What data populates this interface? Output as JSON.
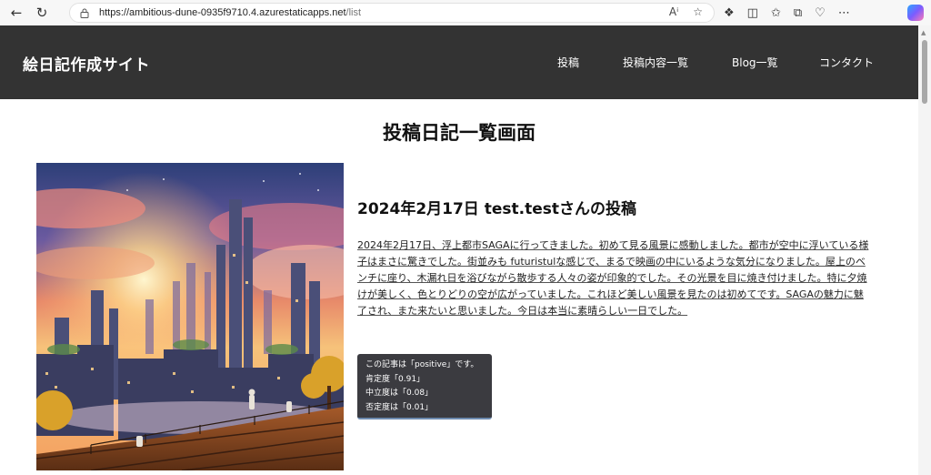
{
  "browser": {
    "url_host": "https://ambitious-dune-0935f9710.4.azurestaticapps.net",
    "url_path": "/list"
  },
  "site": {
    "title": "絵日記作成サイト",
    "nav": [
      "投稿",
      "投稿内容一覧",
      "Blog一覧",
      "コンタクト"
    ]
  },
  "page": {
    "heading": "投稿日記一覧画面"
  },
  "post": {
    "title": "2024年2月17日 test.testさんの投稿",
    "body": "2024年2月17日、浮上都市SAGAに行ってきました。初めて見る風景に感動しました。都市が空中に浮いている様子はまさに驚きでした。街並みも futuristulな感じで、まるで映画の中にいるような気分になりました。屋上のベンチに座り、木漏れ日を浴びながら散歩する人々の姿が印象的でした。その光景を目に焼き付けました。特に夕焼けが美しく、色とりどりの空が広がっていました。これほど美しい風景を見たのは初めてです。SAGAの魅力に魅了され、また来たいと思いました。今日は本当に素晴らしい一日でした。",
    "sentiment": {
      "summary": "この記事は「positive」です。",
      "positive": "肯定度「0.91」",
      "neutral": "中立度は「0.08」",
      "negative": "否定度は「0.01」"
    }
  },
  "icons": {
    "back": "back-arrow-icon",
    "reload": "reload-icon",
    "lock": "lock-icon",
    "read_aloud": "read-aloud-icon",
    "favorite": "star-icon"
  }
}
